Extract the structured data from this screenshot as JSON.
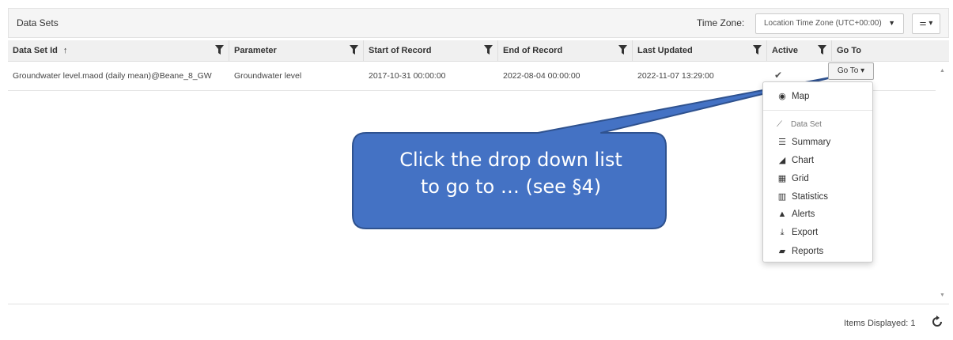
{
  "topbar": {
    "title": "Data Sets",
    "timezone_label": "Time Zone:",
    "timezone_value": "Location Time Zone (UTC+00:00)",
    "timezone_caret": "▼",
    "settings_icon": "⚌ ▾"
  },
  "table": {
    "columns": [
      {
        "label": "Data Set Id",
        "sort_indicator": "↑"
      },
      {
        "label": "Parameter"
      },
      {
        "label": "Start of Record"
      },
      {
        "label": "End of Record"
      },
      {
        "label": "Last Updated"
      },
      {
        "label": "Active"
      },
      {
        "label": "Go To"
      }
    ],
    "rows": [
      {
        "data_set_id": "Groundwater level.maod (daily mean)@Beane_8_GW",
        "parameter": "Groundwater level",
        "start_of_record": "2017-10-31 00:00:00",
        "end_of_record": "2022-08-04 00:00:00",
        "last_updated": "2022-11-07 13:29:00",
        "active": "✔",
        "goto_label": "Go To ▾"
      }
    ]
  },
  "goto_menu": {
    "map": {
      "icon": "globe-icon",
      "glyph": "◉",
      "label": "Map"
    },
    "group_header": {
      "icon": "line-chart-icon",
      "glyph": "⟋",
      "label": "Data Set"
    },
    "items": [
      {
        "icon": "list-icon",
        "glyph": "☰",
        "label": "Summary"
      },
      {
        "icon": "area-chart-icon",
        "glyph": "◢",
        "label": "Chart"
      },
      {
        "icon": "grid-icon",
        "glyph": "▦",
        "label": "Grid"
      },
      {
        "icon": "bar-chart-icon",
        "glyph": "▥",
        "label": "Statistics"
      },
      {
        "icon": "warning-icon",
        "glyph": "▲",
        "label": "Alerts"
      },
      {
        "icon": "download-icon",
        "glyph": "⤓",
        "label": "Export"
      },
      {
        "icon": "book-icon",
        "glyph": "▰",
        "label": "Reports"
      }
    ]
  },
  "callout": {
    "line1": "Click the drop down list",
    "line2": "to go to … (see §4)",
    "color": "#4472c4"
  },
  "footer": {
    "items_displayed": "Items Displayed: 1"
  }
}
